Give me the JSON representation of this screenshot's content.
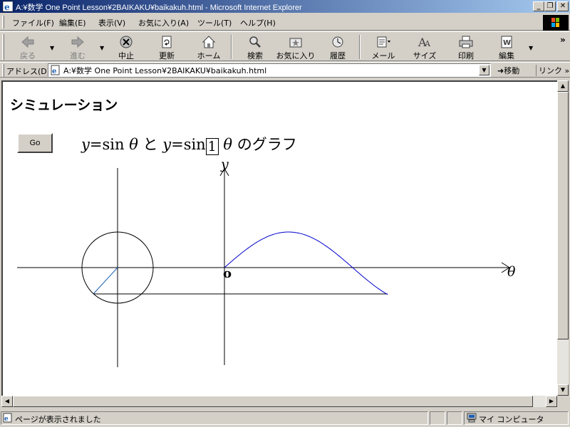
{
  "window": {
    "title": "A:¥数学 One Point Lesson¥2BAIKAKU¥baikakuh.html - Microsoft Internet Explorer",
    "minimize": "_",
    "restore": "❐",
    "close": "✕"
  },
  "menu": {
    "items": [
      "ファイル(F)",
      "編集(E)",
      "表示(V)",
      "お気に入り(A)",
      "ツール(T)",
      "ヘルプ(H)"
    ]
  },
  "toolbar": {
    "back": "戻る",
    "forward": "進む",
    "stop": "中止",
    "refresh": "更新",
    "home": "ホーム",
    "search": "検索",
    "favorites": "お気に入り",
    "history": "履歴",
    "mail": "メール",
    "size": "サイズ",
    "print": "印刷",
    "edit": "編集",
    "more": "»"
  },
  "address": {
    "label": "アドレス(D)",
    "value": "A:¥数学 One Point Lesson¥2BAIKAKU¥baikakuh.html",
    "go": "移動",
    "links": "リンク »"
  },
  "page": {
    "title": "シミュレーション",
    "go_button": "Go",
    "heading_y1": "y",
    "heading_eq1": "=sin",
    "heading_theta1": "θ",
    "heading_and": "と",
    "heading_y2": "y",
    "heading_eq2": "=sin",
    "multiplier": "1",
    "heading_theta2": "θ",
    "heading_tail": "のグラフ",
    "axis_y_label": "y",
    "axis_theta_label": "θ",
    "origin_label": "o"
  },
  "status": {
    "text": "ページが表示されました",
    "zone": "マイ コンピュータ"
  },
  "colors": {
    "curve": "#0000cc",
    "titlebar_start": "#0a246a"
  }
}
